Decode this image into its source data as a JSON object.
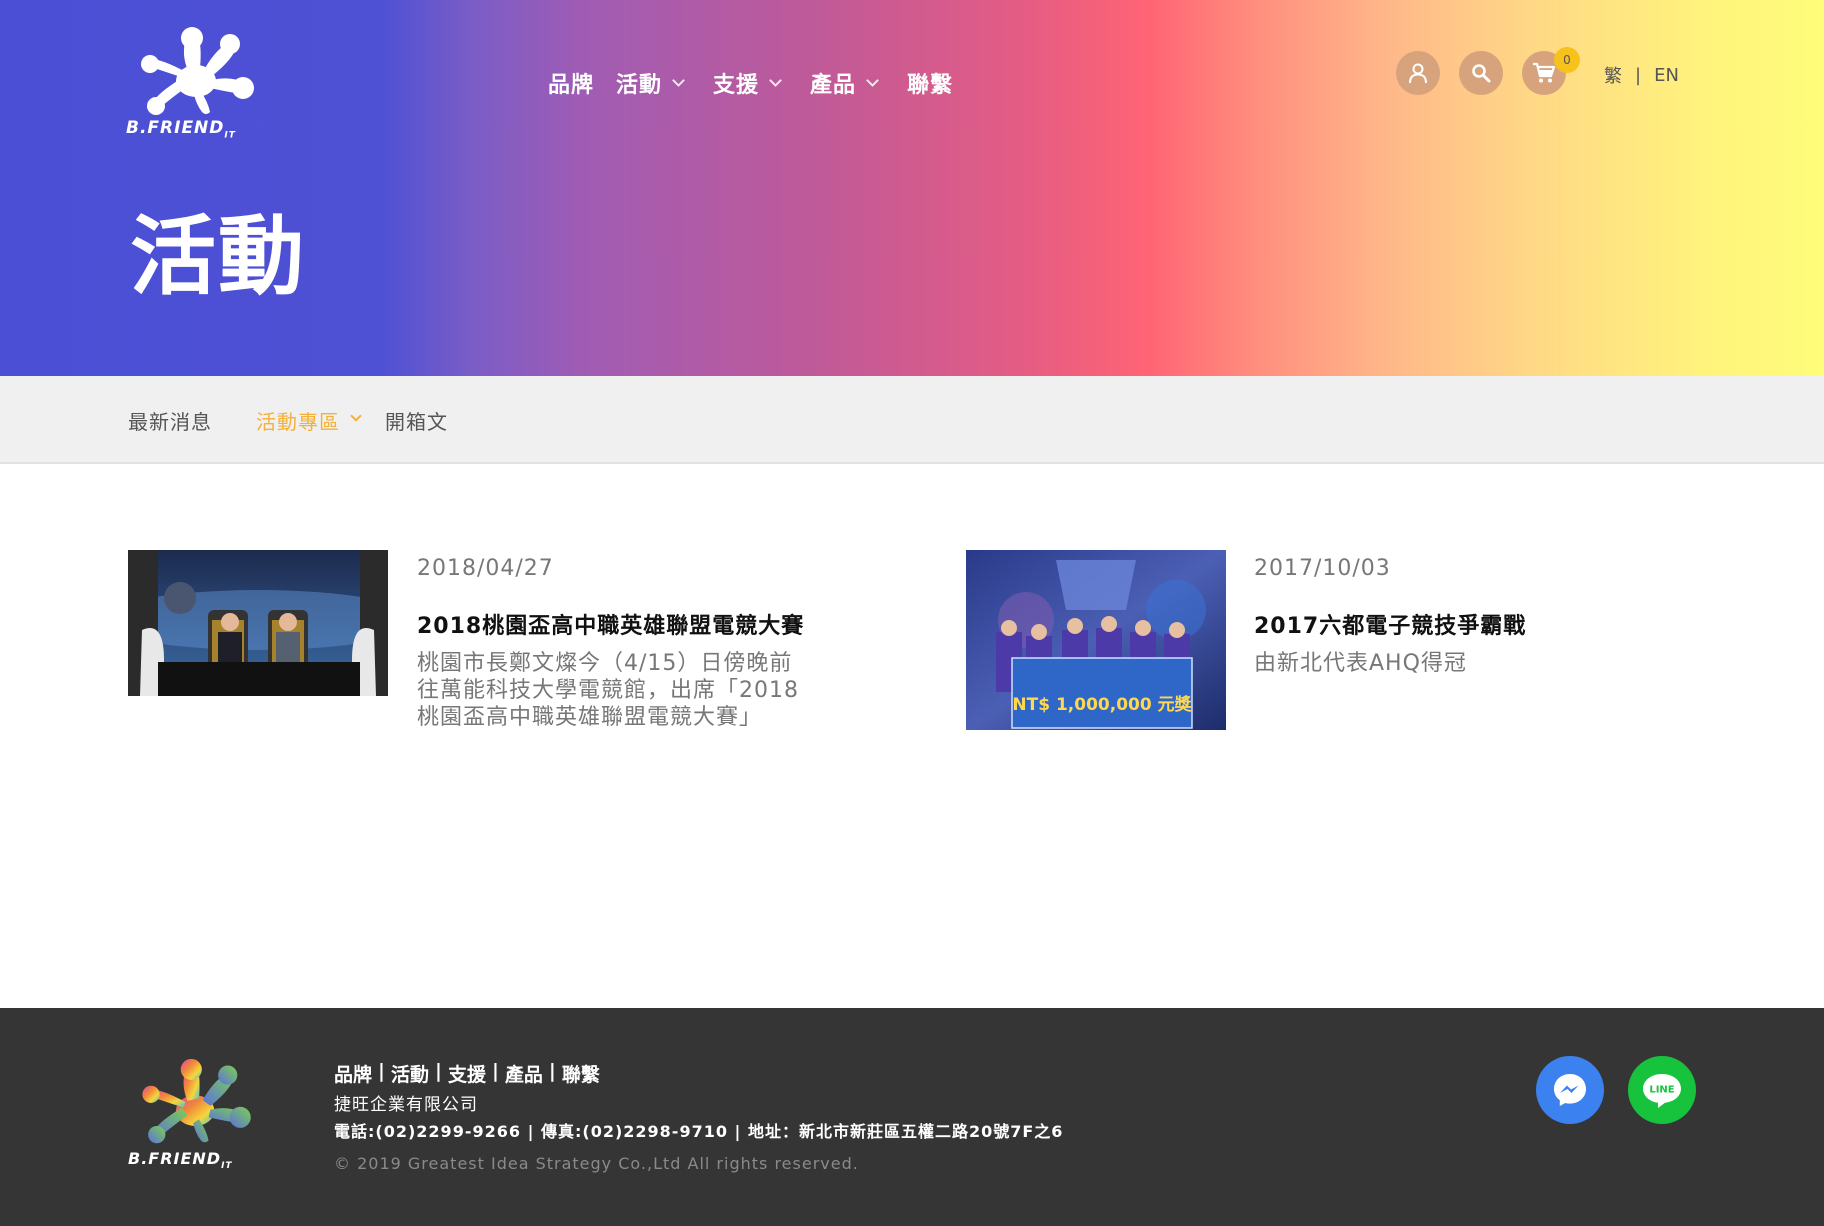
{
  "brand": {
    "logo_text": "B.FRIEND",
    "logo_suffix": "IT"
  },
  "header": {
    "nav": [
      {
        "label": "品牌",
        "has_dropdown": false
      },
      {
        "label": "活動",
        "has_dropdown": true
      },
      {
        "label": "支援",
        "has_dropdown": true
      },
      {
        "label": "產品",
        "has_dropdown": true
      },
      {
        "label": "聯繫",
        "has_dropdown": false
      }
    ],
    "icons": {
      "account": "user-icon",
      "search": "search-icon",
      "cart": "cart-icon"
    },
    "cart_count": "0",
    "lang": {
      "current": "繁",
      "separator": "|",
      "other": "EN"
    }
  },
  "page": {
    "title": "活動"
  },
  "subnav": {
    "items": [
      {
        "label": "最新消息",
        "active": false
      },
      {
        "label": "活動專區",
        "active": true,
        "has_dropdown": true
      },
      {
        "label": "開箱文",
        "active": false
      }
    ]
  },
  "articles": [
    {
      "date": "2018/04/27",
      "title": "2018桃園盃高中職英雄聯盟電競大賽",
      "desc_lines": [
        "桃園市長鄭文燦今（4/15）日傍晚前",
        "往萬能科技大學電競館，出席「2018",
        "桃園盃高中職英雄聯盟電競大賽」"
      ]
    },
    {
      "date": "2017/10/03",
      "title": "2017六都電子競技爭霸戰",
      "desc_lines": [
        "由新北代表AHQ得冠"
      ],
      "image_banner_text": "NT$ 1,000,000 元獎"
    }
  ],
  "footer": {
    "nav": [
      "品牌",
      "活動",
      "支援",
      "產品",
      "聯繫"
    ],
    "nav_separator": "|",
    "company": "捷旺企業有限公司",
    "contact": "電話:(02)2299-9266 | 傳真:(02)2298-9710 | 地址：新北市新莊區五權二路20號7F之6",
    "copyright": "© 2019 Greatest Idea Strategy Co.,Ltd All rights reserved.",
    "social": {
      "messenger": "messenger-icon",
      "line": "LINE"
    }
  },
  "colors": {
    "accent": "#f3b13a",
    "icon_button": "#d6a37c",
    "badge": "#f7c21b",
    "footer_bg": "#353535",
    "subnav_bg": "#f0f0f0",
    "messenger": "#3b82f0",
    "line": "#17c23d"
  }
}
